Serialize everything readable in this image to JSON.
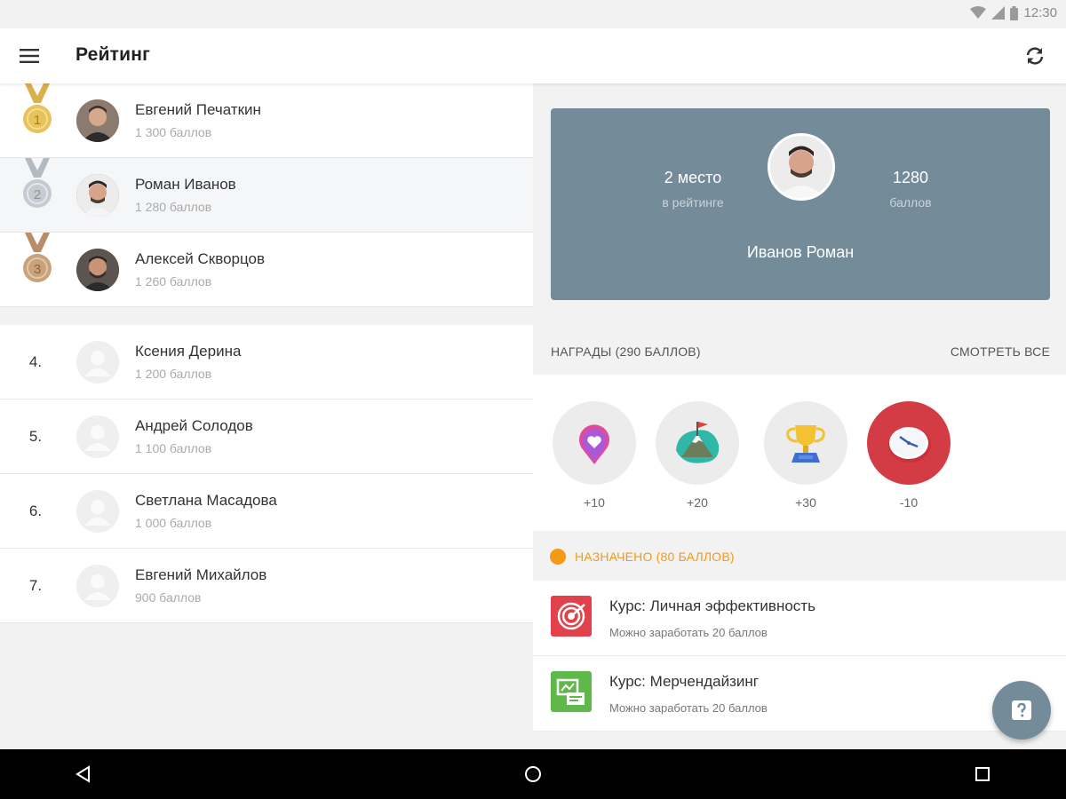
{
  "status_bar": {
    "time": "12:30"
  },
  "app_bar": {
    "title": "Рейтинг"
  },
  "leaders": [
    {
      "place": "1",
      "name": "Евгений Печаткин",
      "points": "1 300 баллов",
      "medal_color": "#e8c25a"
    },
    {
      "place": "2",
      "name": "Роман Иванов",
      "points": "1 280 баллов",
      "medal_color": "#c5cbd1"
    },
    {
      "place": "3",
      "name": "Алексей Скворцов",
      "points": "1 260 баллов",
      "medal_color": "#c9a27c"
    }
  ],
  "ranking": [
    {
      "rank": "4.",
      "name": "Ксения Дерина",
      "points": "1 200 баллов"
    },
    {
      "rank": "5.",
      "name": "Андрей Солодов",
      "points": "1 100 баллов"
    },
    {
      "rank": "6.",
      "name": "Светлана Масадова",
      "points": "1 000 баллов"
    },
    {
      "rank": "7.",
      "name": "Евгений Михайлов",
      "points": "900 баллов"
    }
  ],
  "profile": {
    "place_value": "2 место",
    "place_label": "в рейтинге",
    "score_value": "1280",
    "score_label": "баллов",
    "name": "Иванов Роман"
  },
  "rewards": {
    "header": "НАГРАДЫ (290 БАЛЛОВ)",
    "see_all": "СМОТРЕТЬ ВСЕ",
    "items": [
      {
        "icon": "heart-pin-icon",
        "value": "+10"
      },
      {
        "icon": "mountain-flag-icon",
        "value": "+20"
      },
      {
        "icon": "trophy-icon",
        "value": "+30"
      },
      {
        "icon": "clock-icon",
        "value": "-10"
      }
    ]
  },
  "assigned": {
    "label": "НАЗНАЧЕНО (80 БАЛЛОВ)",
    "accent": "#f59a16",
    "courses": [
      {
        "icon": "target-icon",
        "title": "Курс: Личная эффективность",
        "subtitle": "Можно заработать 20 баллов",
        "color": "#e0414b"
      },
      {
        "icon": "merchandising-icon",
        "title": "Курс: Мерчендайзинг",
        "subtitle": "Можно заработать 20 баллов",
        "color": "#5fb84a"
      }
    ]
  },
  "colors": {
    "card": "#748c99",
    "primary_text": "#333333"
  }
}
